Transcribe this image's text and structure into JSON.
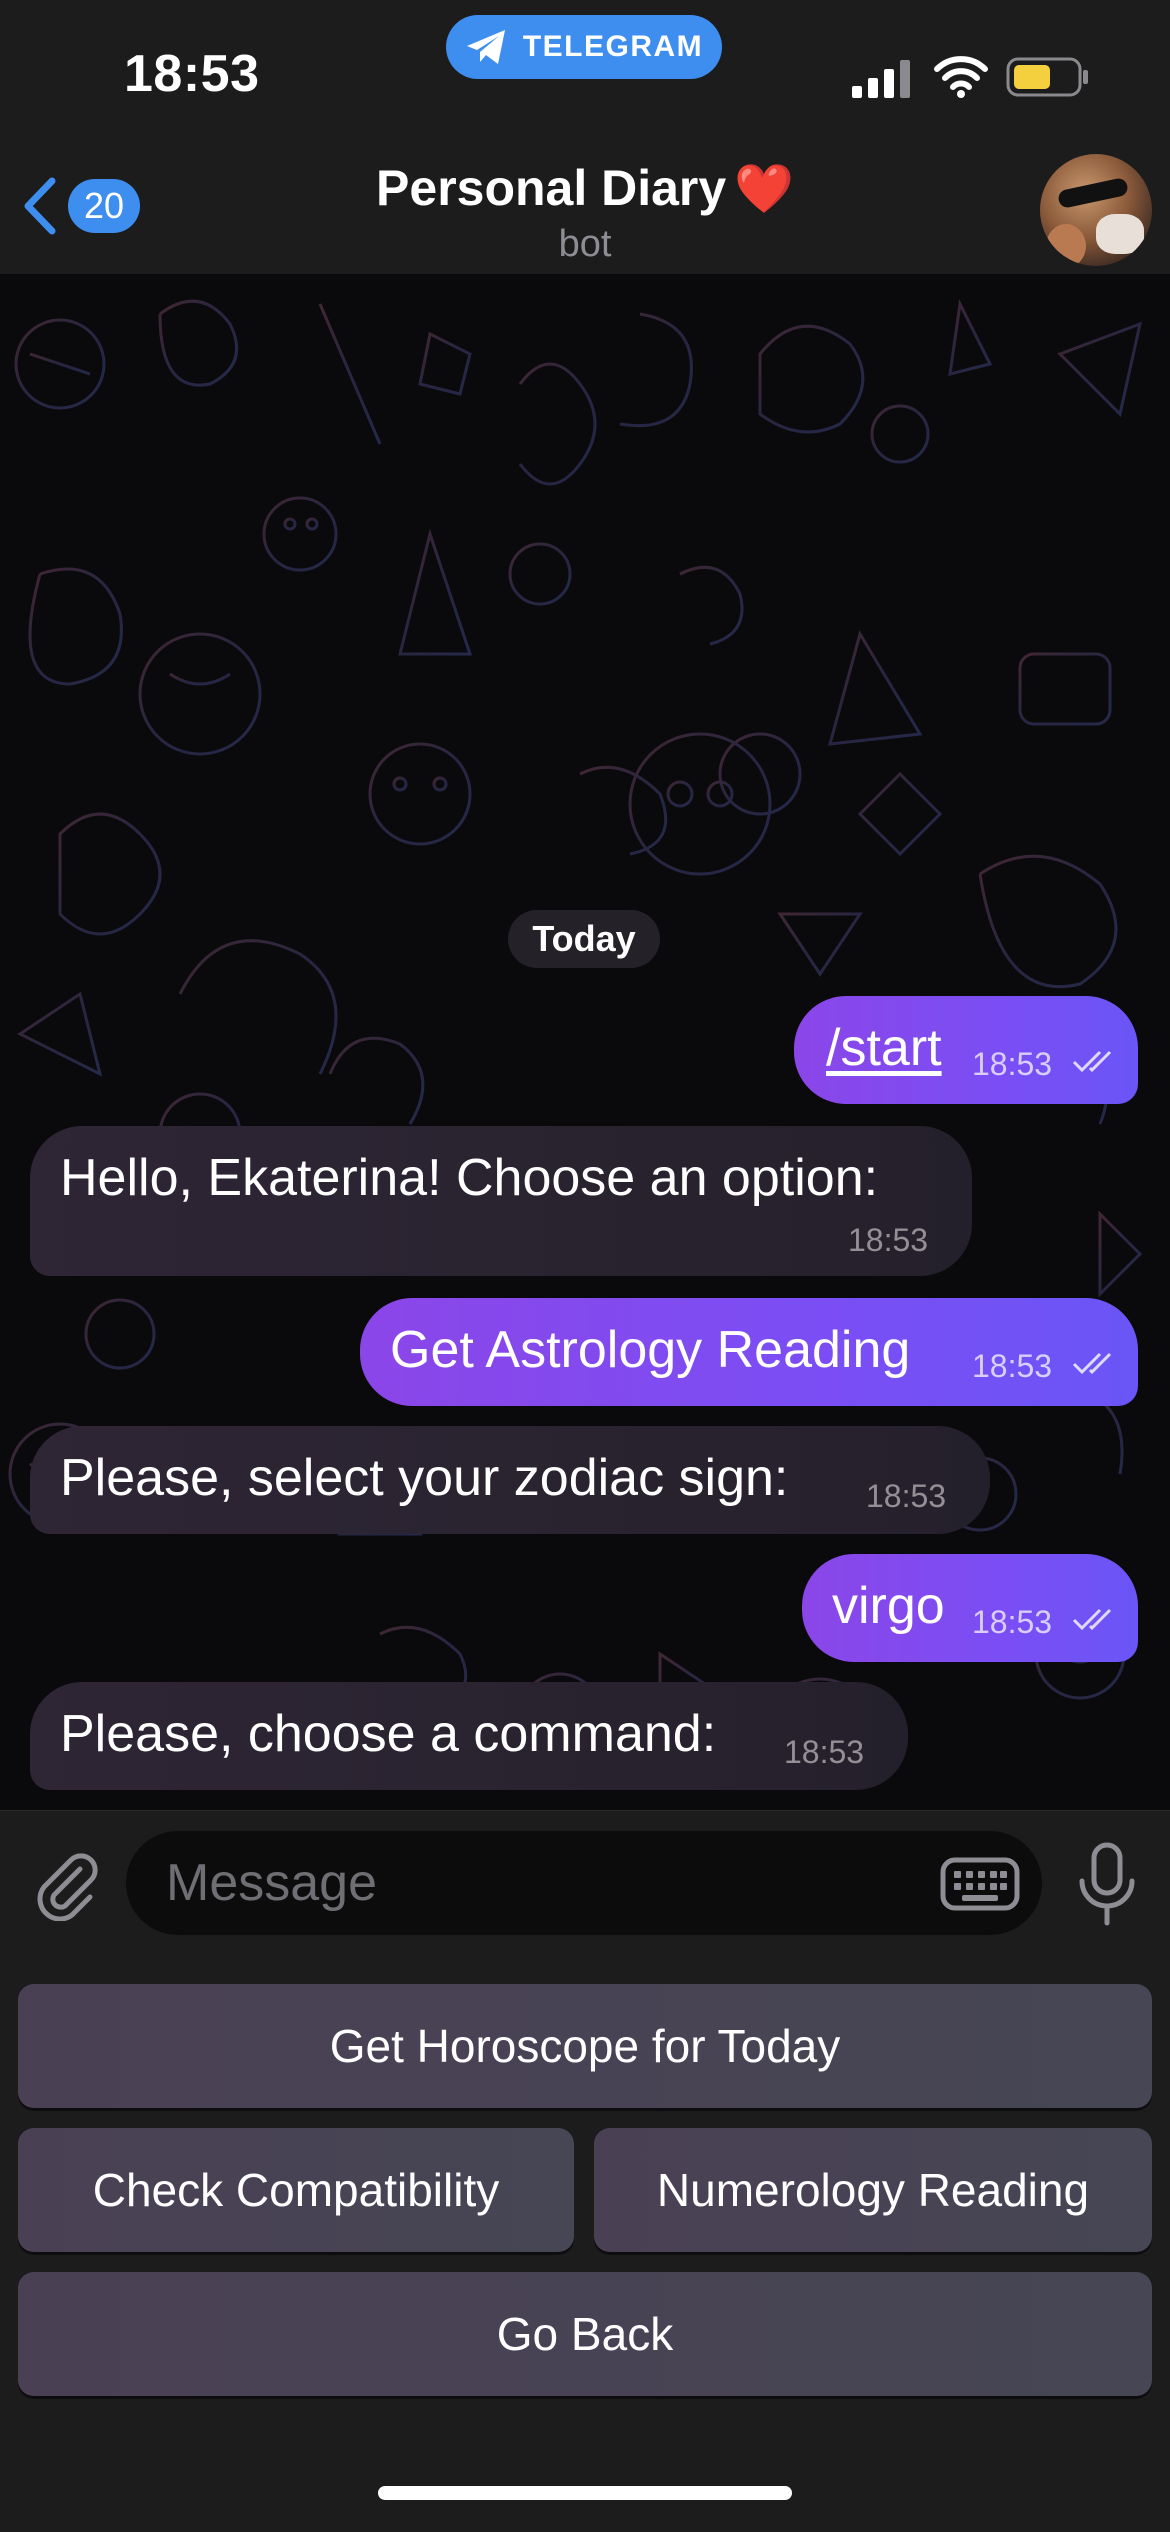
{
  "status_bar": {
    "time": "18:53",
    "app_pill": "TELEGRAM"
  },
  "header": {
    "back_badge": "20",
    "title": "Personal Diary",
    "title_emoji": "❤️",
    "subtitle": "bot",
    "avatar_icon": "profile-photo"
  },
  "chat": {
    "date_label": "Today",
    "messages": [
      {
        "direction": "out",
        "text": "/start",
        "time": "18:53",
        "status": "read"
      },
      {
        "direction": "in",
        "text": "Hello, Ekaterina! Choose an option:",
        "time": "18:53"
      },
      {
        "direction": "out",
        "text": "Get Astrology Reading",
        "time": "18:53",
        "status": "read"
      },
      {
        "direction": "in",
        "text": "Please, select your zodiac sign:",
        "time": "18:53"
      },
      {
        "direction": "out",
        "text": "virgo",
        "time": "18:53",
        "status": "read"
      },
      {
        "direction": "in",
        "text": "Please, choose a command:",
        "time": "18:53"
      }
    ]
  },
  "composer": {
    "placeholder": "Message",
    "value": ""
  },
  "reply_keyboard": {
    "buttons": [
      "Get Horoscope for Today",
      "Check Compatibility",
      "Numerology Reading",
      "Go Back"
    ]
  },
  "colors": {
    "accent": "#3e8ef0",
    "outgoing_bubble": "#7a4ef4",
    "incoming_bubble": "#2a2330",
    "heart": "#e0242b",
    "battery": "#f4d03f"
  }
}
